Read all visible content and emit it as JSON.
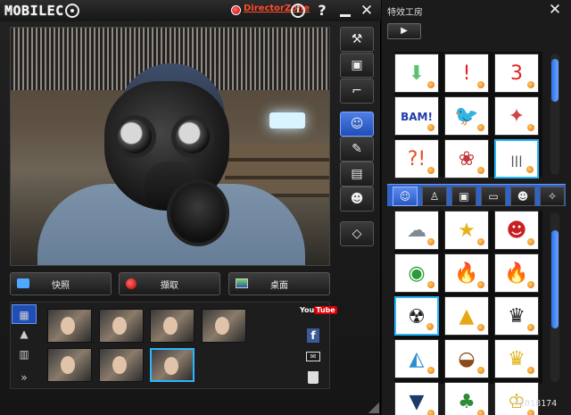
{
  "app": {
    "logo_text": "MOBILEC",
    "director_link": "DirectorZone"
  },
  "titlebar": {
    "info_icon": "info-icon",
    "help_glyph": "?",
    "close_glyph": "✕"
  },
  "tools": [
    "wrench-icon",
    "frame-icon",
    "cctv-camera-icon",
    "avatar-effect-icon",
    "pencil-icon",
    "overlay-frame-icon",
    "face-add-icon",
    "eraser-icon"
  ],
  "actions": {
    "snapshot_label": "快照",
    "record_label": "擷取",
    "desktop_label": "桌面"
  },
  "gallery": {
    "side_nav": [
      "photos-icon",
      "portrait-icon",
      "video-icon",
      "expand-icon"
    ],
    "share": {
      "youtube_you": "You",
      "youtube_tube": "Tube",
      "facebook_glyph": "f"
    }
  },
  "effects_panel": {
    "title": "特效工房",
    "camera_button_glyph": "▶",
    "close_glyph": "✕",
    "top_grid": [
      {
        "name": "arrow-down-effect",
        "glyph": "⬇",
        "color": "#5bc36b"
      },
      {
        "name": "exclamation-effect",
        "glyph": "!",
        "color": "#e52020"
      },
      {
        "name": "number-three-effect",
        "glyph": "3",
        "color": "#e52020"
      },
      {
        "name": "bam-effect",
        "glyph": "BAM!",
        "color": "#1f3ba8"
      },
      {
        "name": "bird-effect",
        "glyph": "🐦",
        "color": "#111111"
      },
      {
        "name": "sparkle-effect",
        "glyph": "✦",
        "color": "#d04444"
      },
      {
        "name": "question-marks-effect",
        "glyph": "?!",
        "color": "#e54f2a"
      },
      {
        "name": "petals-effect",
        "glyph": "❀",
        "color": "#c13a3a"
      },
      {
        "name": "static-lines-effect",
        "glyph": "|||",
        "color": "#555555"
      }
    ],
    "tabs": [
      "face-mask-tab-icon",
      "hat-tab-icon",
      "frame-tab-icon",
      "screen-tab-icon",
      "emoticon-tab-icon",
      "magic-wand-tab-icon"
    ],
    "bottom_grid": [
      {
        "name": "cloud-effect",
        "glyph": "☁",
        "color": "#7f8a95"
      },
      {
        "name": "star-effect",
        "glyph": "★",
        "color": "#e8b21a"
      },
      {
        "name": "red-face-effect",
        "glyph": "☻",
        "color": "#c82020"
      },
      {
        "name": "green-eyes-effect",
        "glyph": "◉",
        "color": "#2a9b3a"
      },
      {
        "name": "fire-effect",
        "glyph": "🔥",
        "color": "#f07a10"
      },
      {
        "name": "flames-effect",
        "glyph": "🔥",
        "color": "#f05a10"
      },
      {
        "name": "gas-mask-effect",
        "glyph": "☢",
        "color": "#222222"
      },
      {
        "name": "party-hat-effect",
        "glyph": "▲",
        "color": "#e7a614"
      },
      {
        "name": "police-cap-effect",
        "glyph": "♛",
        "color": "#222222"
      },
      {
        "name": "opera-house-effect",
        "glyph": "◭",
        "color": "#2a8fd0"
      },
      {
        "name": "cowboy-hat-effect",
        "glyph": "◒",
        "color": "#8b4a1a"
      },
      {
        "name": "crown-effect",
        "glyph": "♛",
        "color": "#e2b416"
      },
      {
        "name": "graduation-cap-effect",
        "glyph": "▼",
        "color": "#1e3a6a"
      },
      {
        "name": "leaf-crown-effect",
        "glyph": "♣",
        "color": "#2e8b3a"
      },
      {
        "name": "gold-crown-effect",
        "glyph": "♔",
        "color": "#d8a814"
      }
    ]
  },
  "watermark": "#2018174",
  "colors": {
    "accent_blue": "#2f63c9",
    "selection_cyan": "#2ab7ff",
    "link_red": "#ff4b2b"
  }
}
